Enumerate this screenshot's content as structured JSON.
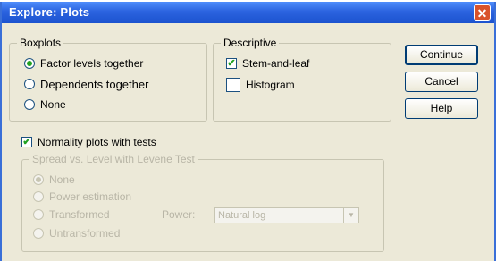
{
  "dialog": {
    "title": "Explore: Plots"
  },
  "boxplots": {
    "legend": "Boxplots",
    "options": [
      "Factor levels together",
      "Dependents together",
      "None"
    ],
    "selected": "Factor levels together"
  },
  "descriptive": {
    "legend": "Descriptive",
    "stem_and_leaf": {
      "label": "Stem-and-leaf",
      "checked": true
    },
    "histogram": {
      "label": "Histogram",
      "checked": false
    }
  },
  "buttons": {
    "continue": "Continue",
    "cancel": "Cancel",
    "help": "Help"
  },
  "normality": {
    "label": "Normality plots with tests",
    "checked": true
  },
  "spread": {
    "legend": "Spread vs. Level with Levene Test",
    "options": [
      "None",
      "Power estimation",
      "Transformed",
      "Untransformed"
    ],
    "selected": "None",
    "power_label": "Power:",
    "power_value": "Natural log"
  },
  "colors": {
    "title_bar": "#2b63df",
    "dialog_bg": "#ece9d8",
    "check_mark": "#21a121"
  }
}
